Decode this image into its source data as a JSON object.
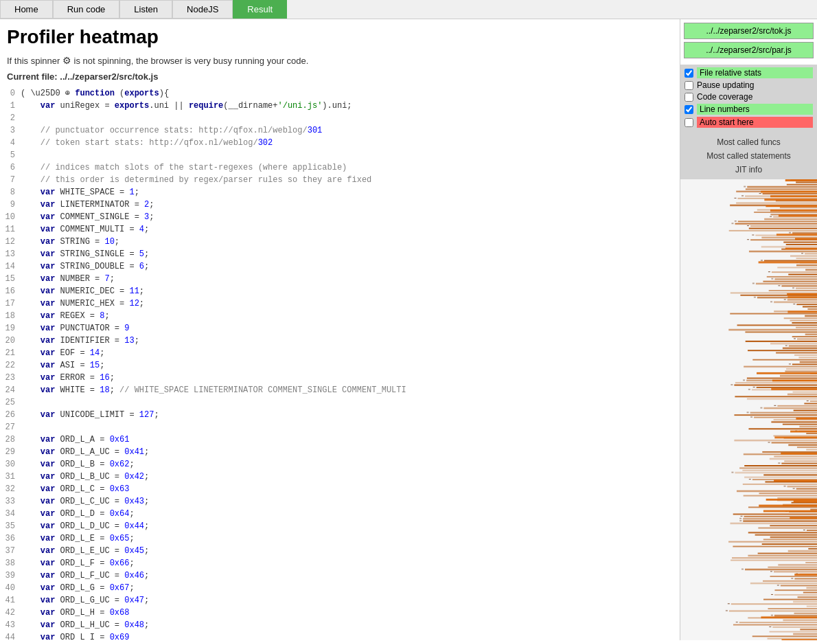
{
  "nav": {
    "tabs": [
      {
        "id": "home",
        "label": "Home",
        "active": false
      },
      {
        "id": "run-code",
        "label": "Run code",
        "active": false
      },
      {
        "id": "listen",
        "label": "Listen",
        "active": false
      },
      {
        "id": "nodejs",
        "label": "NodeJS",
        "active": false
      },
      {
        "id": "result",
        "label": "Result",
        "active": true
      }
    ]
  },
  "page": {
    "title": "Profiler heatmap",
    "spinner_text": "If this spinner",
    "spinner_suffix": " is not spinning, the browser is very busy running your code.",
    "current_file_label": "Current file:",
    "current_file_path": "../../zeparser2/src/tok.js"
  },
  "file_buttons": [
    {
      "label": "../../zeparser2/src/tok.js"
    },
    {
      "label": "../../zeparser2/src/par.js"
    }
  ],
  "checkboxes": [
    {
      "id": "file-relative-stats",
      "label": "File relative stats",
      "checked": true,
      "style": "green"
    },
    {
      "id": "pause-updating",
      "label": "Pause updating",
      "checked": false,
      "style": "plain"
    },
    {
      "id": "code-coverage",
      "label": "Code coverage",
      "checked": false,
      "style": "plain"
    },
    {
      "id": "line-numbers",
      "label": "Line numbers",
      "checked": true,
      "style": "green"
    },
    {
      "id": "auto-start-here",
      "label": "Auto start here",
      "checked": false,
      "style": "red"
    }
  ],
  "menu_items": [
    {
      "id": "most-called-funcs",
      "label": "Most called funcs"
    },
    {
      "id": "most-called-statements",
      "label": "Most called statements"
    },
    {
      "id": "jit-info",
      "label": "JIT info"
    }
  ],
  "code": {
    "lines": [
      {
        "num": "0",
        "content": "( \\u25D0 ⊕ function (exports){"
      },
      {
        "num": "1",
        "content": "    var uniRegex = exports.uni || require(__dirname+'/uni.js').uni;"
      },
      {
        "num": "2",
        "content": ""
      },
      {
        "num": "3",
        "content": "    // punctuator occurrence stats: http://qfox.nl/weblog/301"
      },
      {
        "num": "4",
        "content": "    // token start stats: http://qfox.nl/weblog/302"
      },
      {
        "num": "5",
        "content": ""
      },
      {
        "num": "6",
        "content": "    // indices match slots of the start-regexes (where applicable)"
      },
      {
        "num": "7",
        "content": "    // this order is determined by regex/parser rules so they are fixed"
      },
      {
        "num": "8",
        "content": "    var WHITE_SPACE = 1;"
      },
      {
        "num": "9",
        "content": "    var LINETERMINATOR = 2;"
      },
      {
        "num": "10",
        "content": "    var COMMENT_SINGLE = 3;"
      },
      {
        "num": "11",
        "content": "    var COMMENT_MULTI = 4;"
      },
      {
        "num": "12",
        "content": "    var STRING = 10;"
      },
      {
        "num": "13",
        "content": "    var STRING_SINGLE = 5;"
      },
      {
        "num": "14",
        "content": "    var STRING_DOUBLE = 6;"
      },
      {
        "num": "15",
        "content": "    var NUMBER = 7;"
      },
      {
        "num": "16",
        "content": "    var NUMERIC_DEC = 11;"
      },
      {
        "num": "17",
        "content": "    var NUMERIC_HEX = 12;"
      },
      {
        "num": "18",
        "content": "    var REGEX = 8;"
      },
      {
        "num": "19",
        "content": "    var PUNCTUATOR = 9"
      },
      {
        "num": "20",
        "content": "    var IDENTIFIER = 13;"
      },
      {
        "num": "21",
        "content": "    var EOF = 14;"
      },
      {
        "num": "22",
        "content": "    var ASI = 15;"
      },
      {
        "num": "23",
        "content": "    var ERROR = 16;"
      },
      {
        "num": "24",
        "content": "    var WHITE = 18; // WHITE_SPACE LINETERMINATOR COMMENT_SINGLE COMMENT_MULTI"
      },
      {
        "num": "25",
        "content": ""
      },
      {
        "num": "26",
        "content": "    var UNICODE_LIMIT = 127;"
      },
      {
        "num": "27",
        "content": ""
      },
      {
        "num": "28",
        "content": "    var ORD_L_A = 0x61"
      },
      {
        "num": "29",
        "content": "    var ORD_L_A_UC = 0x41;"
      },
      {
        "num": "30",
        "content": "    var ORD_L_B = 0x62;"
      },
      {
        "num": "31",
        "content": "    var ORD_L_B_UC = 0x42;"
      },
      {
        "num": "32",
        "content": "    var ORD_L_C = 0x63"
      },
      {
        "num": "33",
        "content": "    var ORD_L_C_UC = 0x43;"
      },
      {
        "num": "34",
        "content": "    var ORD_L_D = 0x64;"
      },
      {
        "num": "35",
        "content": "    var ORD_L_D_UC = 0x44;"
      },
      {
        "num": "36",
        "content": "    var ORD_L_E = 0x65;"
      },
      {
        "num": "37",
        "content": "    var ORD_L_E_UC = 0x45;"
      },
      {
        "num": "38",
        "content": "    var ORD_L_F = 0x66;"
      },
      {
        "num": "39",
        "content": "    var ORD_L_F_UC = 0x46;"
      },
      {
        "num": "40",
        "content": "    var ORD_L_G = 0x67;"
      },
      {
        "num": "41",
        "content": "    var ORD_L_G_UC = 0x47;"
      },
      {
        "num": "42",
        "content": "    var ORD_L_H = 0x68"
      },
      {
        "num": "43",
        "content": "    var ORD_L_H_UC = 0x48;"
      },
      {
        "num": "44",
        "content": "    var ORD_L_I = 0x69"
      }
    ]
  }
}
